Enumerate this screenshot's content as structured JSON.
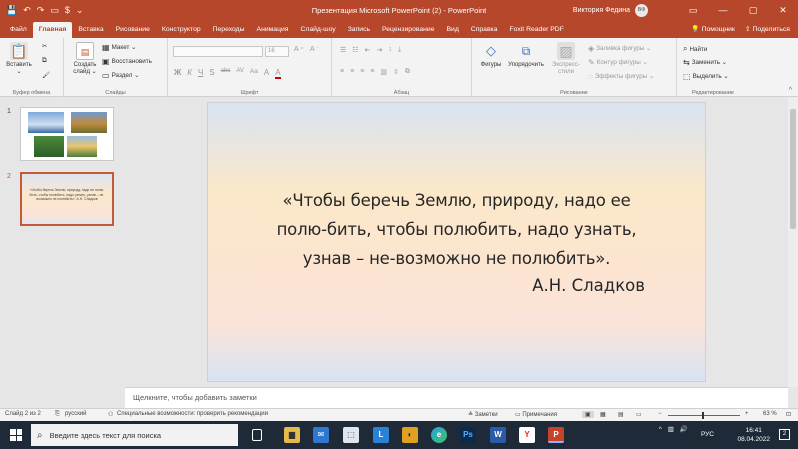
{
  "titlebar": {
    "title": "Презентация Microsoft PowerPoint (2)  -  PowerPoint",
    "user_name": "Виктория Федина",
    "user_initials": "ВФ",
    "qat_save": "💾",
    "qat_undo": "↶",
    "qat_redo": "↷",
    "qat_present": "▭",
    "qat_more": "$",
    "qat_customize": "⌄",
    "ribbon_display": "▭",
    "minimize": "—",
    "maximize": "▢",
    "close": "✕"
  },
  "tabs": [
    {
      "label": "Файл"
    },
    {
      "label": "Главная"
    },
    {
      "label": "Вставка"
    },
    {
      "label": "Рисование"
    },
    {
      "label": "Конструктор"
    },
    {
      "label": "Переходы"
    },
    {
      "label": "Анимация"
    },
    {
      "label": "Слайд-шоу"
    },
    {
      "label": "Запись"
    },
    {
      "label": "Рецензирование"
    },
    {
      "label": "Вид"
    },
    {
      "label": "Справка"
    },
    {
      "label": "Foxit Reader PDF"
    }
  ],
  "tabs_right": {
    "lightbulb": "💡",
    "help": "Помощник",
    "share": "Поделиться"
  },
  "ribbon": {
    "clipboard": {
      "label": "Буфер обмена",
      "paste": "Вставить",
      "paste_arrow": "⌄",
      "cut": "✂",
      "copy": "⧉",
      "format_painter": "🖌"
    },
    "slides": {
      "label": "Слайды",
      "new_slide": "Создать",
      "new_slide2": "слайд ⌄",
      "layout": "Макет ⌄",
      "reset": "Восстановить",
      "section": "Раздел ⌄"
    },
    "font": {
      "label": "Шрифт",
      "size": "16",
      "bold": "Ж",
      "italic": "К",
      "underline": "Ч",
      "strike": "S",
      "shadow": "abc",
      "spacing": "AV",
      "case": "Aa",
      "clear": "A",
      "color": "A"
    },
    "paragraph": {
      "label": "Абзац"
    },
    "drawing": {
      "label": "Рисование",
      "shapes": "Фигуры",
      "arrange": "Упорядочить",
      "quick_styles": "Экспресс-стили",
      "fill": "Заливка фигуры ⌄",
      "outline": "Контур фигуры ⌄",
      "effects": "Эффекты фигуры ⌄"
    },
    "editing": {
      "label": "Редактирование",
      "find": "Найти",
      "replace": "Заменить ⌄",
      "select": "Выделить ⌄"
    }
  },
  "thumbnails": [
    {
      "number": "1"
    },
    {
      "number": "2",
      "text": "«Чтобы беречь Землю, природу, надо ее полю-бить, чтобы полюбить, надо узнать, узнав – не-возможно не полюбить». А.Н. Сладков"
    }
  ],
  "slide": {
    "quote_line1": "«Чтобы беречь Землю, природу, надо ее",
    "quote_line2": "полю-бить, чтобы полюбить, надо узнать,",
    "quote_line3": "узнав – не-возможно не полюбить».",
    "author": "А.Н. Сладков"
  },
  "notes": {
    "placeholder": "Щелкните, чтобы добавить заметки"
  },
  "status": {
    "slide_counter": "Слайд 2 из 2",
    "language": "русский",
    "accessibility": "Специальные возможности: проверить рекомендации",
    "notes": "Заметки",
    "comments": "Примечания",
    "zoom_minus": "−",
    "zoom_plus": "+",
    "zoom": "63 %",
    "zoom_level_pct": 63
  },
  "taskbar": {
    "search_placeholder": "Введите здесь текст для поиска",
    "language": "РУС",
    "time": "16:41",
    "date": "08.04.2022",
    "notifications": "2",
    "search_icon": "⌕",
    "tray_chevron": "^",
    "tray_volume": "🔊"
  }
}
